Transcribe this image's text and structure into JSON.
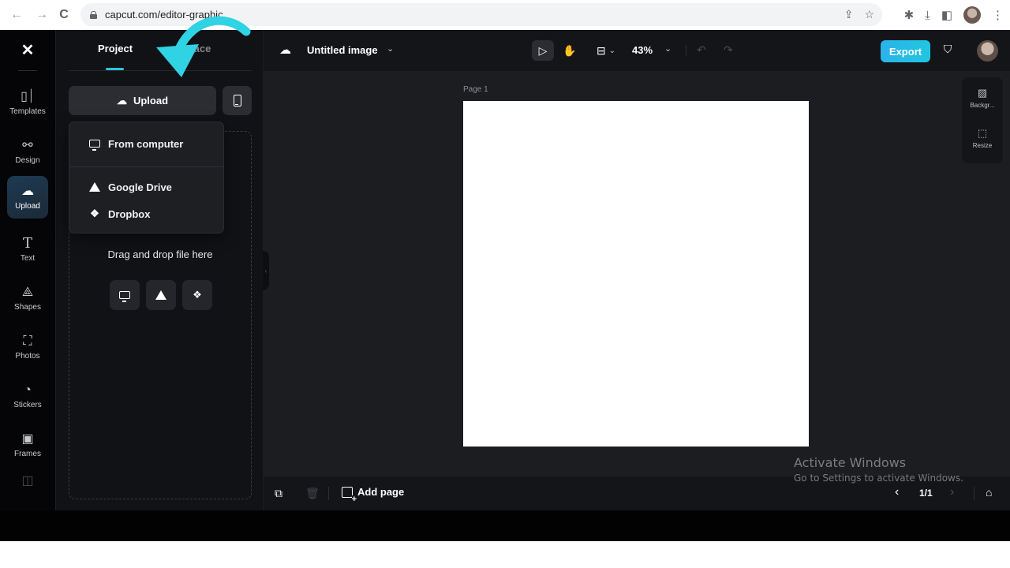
{
  "browser": {
    "url": "capcut.com/editor-graphic",
    "back_icon": "←",
    "forward_icon": "→",
    "reload_icon": "C",
    "share_icon": "⇪",
    "star_icon": "☆",
    "extensions_icon": "✱",
    "download_icon": "⤓",
    "sidepanel_icon": "◧",
    "menu_icon": "⋮"
  },
  "rail": {
    "logo": "✕",
    "items": [
      {
        "label": "Templates",
        "icon": "▯⏐"
      },
      {
        "label": "Design",
        "icon": "⚯"
      },
      {
        "label": "Upload",
        "icon": "☁"
      },
      {
        "label": "Text",
        "icon": "T"
      },
      {
        "label": "Shapes",
        "icon": "⟁"
      },
      {
        "label": "Photos",
        "icon": "⛶"
      },
      {
        "label": "Stickers",
        "icon": "◔"
      },
      {
        "label": "Frames",
        "icon": "▣"
      },
      {
        "label": "",
        "icon": "◫"
      }
    ]
  },
  "panel": {
    "tabs": [
      {
        "label": "Project"
      },
      {
        "label": "Space"
      }
    ],
    "upload_button": "Upload",
    "upload_icon": "☁",
    "menu": {
      "items": [
        {
          "label": "From computer"
        },
        {
          "label": "Google Drive"
        },
        {
          "label": "Dropbox",
          "icon": "❖"
        }
      ]
    },
    "drop_label": "Drag and drop file here",
    "dropbox_glyph": "❖"
  },
  "topbar": {
    "doc_icon": "☁",
    "title": "Untitled image",
    "chevron": "⌄",
    "select_icon": "▷",
    "hand_icon": "✋",
    "layout_icon": "⊟",
    "zoom": "43%",
    "undo_icon": "↶",
    "redo_icon": "↷",
    "export_label": "Export",
    "shield_icon": "⛉"
  },
  "canvas": {
    "page_label": "Page 1",
    "side_tools": [
      {
        "label": "Backgr...",
        "icon": "▨"
      },
      {
        "label": "Resize",
        "icon": "⬚"
      }
    ],
    "collapse_icon": "‹"
  },
  "bottombar": {
    "duplicate_icon": "⧉",
    "trash_icon": "🗑",
    "add_page": "Add page",
    "prev_icon": "‹",
    "page_count": "1/1",
    "next_icon": "›",
    "expand_icon": "⌂"
  },
  "watermark": {
    "line1": "Activate Windows",
    "line2": "Go to Settings to activate Windows."
  },
  "colors": {
    "accent": "#2ec3d9",
    "export": "#22bde6",
    "annotation_arrow": "#2fd3e3"
  }
}
